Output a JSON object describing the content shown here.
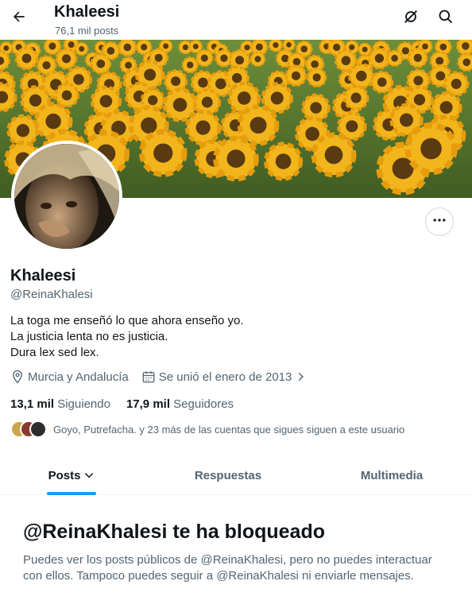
{
  "header": {
    "title": "Khaleesi",
    "posts_count": "76,1 mil posts"
  },
  "profile": {
    "name": "Khaleesi",
    "handle": "@ReinaKhalesi",
    "bio_lines": [
      "La toga me enseñó lo que ahora enseño yo.",
      "La justicia lenta no es justicia.",
      "Dura lex sed lex."
    ],
    "location": "Murcia y Andalucía",
    "joined": "Se unió el enero de 2013",
    "following_count": "13,1 mil",
    "following_label": "Siguiendo",
    "followers_count": "17,9 mil",
    "followers_label": "Seguidores",
    "followed_by_text": "Goyo, Putrefacha. y 23 más de las cuentas que sigues siguen a este usuario"
  },
  "tabs": [
    {
      "label": "Posts",
      "active": true
    },
    {
      "label": "Respuestas",
      "active": false
    },
    {
      "label": "Multimedia",
      "active": false
    }
  ],
  "blocked": {
    "title": "@ReinaKhalesi te ha bloqueado",
    "message": "Puedes ver los posts públicos de @ReinaKhalesi, pero no puedes interactuar con ellos. Tampoco puedes seguir a @ReinaKhalesi ni enviarle mensajes."
  },
  "icons": {
    "back": "arrow-left-icon",
    "grok": "grok-icon",
    "search": "search-icon",
    "more": "more-horizontal-icon",
    "location": "location-pin-icon",
    "calendar": "calendar-icon",
    "chevron": "chevron-right-icon",
    "tab_chevron": "chevron-down-icon"
  },
  "colors": {
    "accent": "#1d9bf0",
    "text_primary": "#0f1419",
    "text_secondary": "#536471"
  }
}
